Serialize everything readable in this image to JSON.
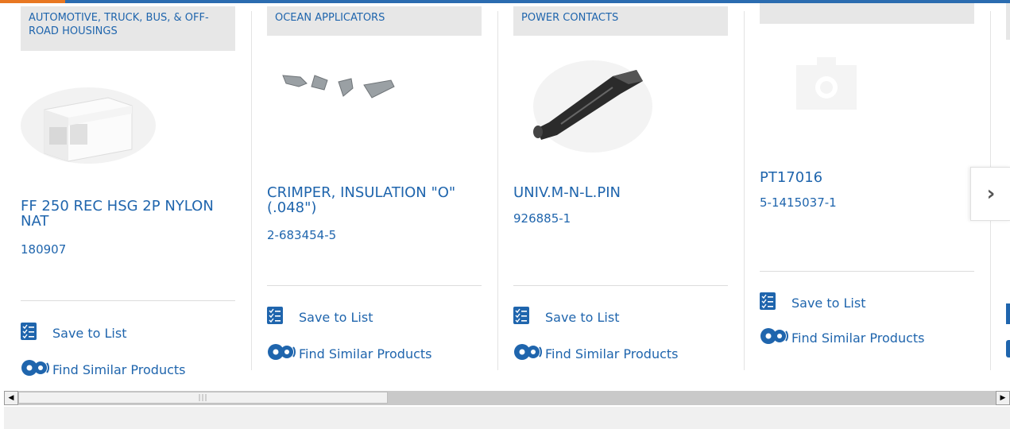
{
  "cards": [
    {
      "category": "AUTOMOTIVE, TRUCK, BUS, & OFF-ROAD HOUSINGS",
      "name": "FF 250 REC HSG 2P NYLON NAT",
      "part_number": "180907",
      "save_label": "Save to List",
      "similar_label": "Find Similar Products"
    },
    {
      "category": "OCEAN APPLICATORS",
      "name": "CRIMPER, INSULATION \"O\"(.048\")",
      "part_number": "2-683454-5",
      "save_label": "Save to List",
      "similar_label": "Find Similar Products"
    },
    {
      "category": "POWER CONTACTS",
      "name": "UNIV.M-N-L.PIN",
      "part_number": "926885-1",
      "save_label": "Save to List",
      "similar_label": "Find Similar Products"
    },
    {
      "category": "",
      "name": "PT17016",
      "part_number": "5-1415037-1",
      "save_label": "Save to List",
      "similar_label": "Find Similar Products"
    }
  ],
  "icons": {
    "next": "chevron-right-icon",
    "save": "checklist-icon",
    "similar": "gears-icon",
    "placeholder": "camera-placeholder-icon"
  },
  "carousel": {
    "next_glyph": "›"
  },
  "scrollbar": {
    "left_glyph": "◀",
    "right_glyph": "▶",
    "grip": "|||"
  },
  "colors": {
    "link": "#1f65ad",
    "category_bg": "#e7e7e7",
    "accent": "#e87722",
    "primary": "#2b6cb0"
  }
}
